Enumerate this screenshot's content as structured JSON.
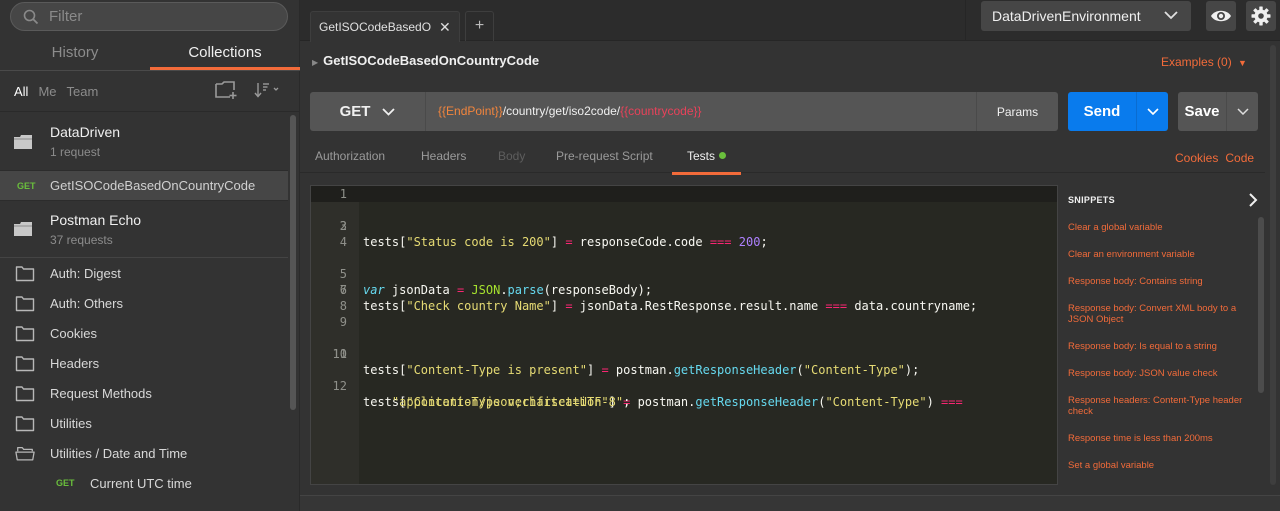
{
  "sidebar": {
    "filter_placeholder": "Filter",
    "tabs": [
      {
        "label": "History",
        "active": false
      },
      {
        "label": "Collections",
        "active": true
      }
    ],
    "owner_filters": [
      {
        "label": "All",
        "active": true
      },
      {
        "label": "Me",
        "active": false
      },
      {
        "label": "Team",
        "active": false
      }
    ],
    "collections": [
      {
        "name": "DataDriven",
        "count": "1 request"
      },
      {
        "name": "Postman Echo",
        "count": "37 requests"
      }
    ],
    "selected_request": {
      "method": "GET",
      "name": "GetISOCodeBasedOnCountryCode"
    },
    "folders": [
      {
        "name": "Auth: Digest"
      },
      {
        "name": "Auth: Others"
      },
      {
        "name": "Cookies"
      },
      {
        "name": "Headers"
      },
      {
        "name": "Request Methods"
      },
      {
        "name": "Utilities"
      },
      {
        "name": "Utilities / Date and Time"
      }
    ],
    "sub_request": {
      "method": "GET",
      "name": "Current UTC time"
    }
  },
  "tabbar": {
    "active_tab": "GetISOCodeBasedOnCountryCode",
    "close_glyph": "✕",
    "new_tab_glyph": "+"
  },
  "environment": {
    "selected": "DataDrivenEnvironment"
  },
  "request": {
    "title": "GetISOCodeBasedOnCountryCode",
    "examples_label": "Examples (0)",
    "method": "GET",
    "url": {
      "var1": "{{EndPoint}}",
      "path": "/country/get/iso2code/",
      "var2": "{{countrycode}}"
    },
    "params_label": "Params",
    "send_label": "Send",
    "save_label": "Save"
  },
  "subtabs": [
    {
      "label": "Authorization",
      "state": "normal"
    },
    {
      "label": "Headers",
      "state": "normal"
    },
    {
      "label": "Body",
      "state": "disabled"
    },
    {
      "label": "Pre-request Script",
      "state": "normal"
    },
    {
      "label": "Tests",
      "state": "active"
    }
  ],
  "right_links": [
    "Cookies",
    "Code"
  ],
  "editor": {
    "line_numbers": [
      "1",
      "2",
      "3",
      "4",
      "5",
      "6",
      "7",
      "8",
      "9",
      "10",
      "11",
      "12"
    ],
    "lines": {
      "l2": [
        "tests[",
        "\"Status code is 200\"",
        "] ",
        "=",
        " responseCode.code ",
        "===",
        " ",
        "200",
        ";"
      ],
      "l5": [
        "var",
        " jsonData ",
        "=",
        " ",
        "JSON",
        ".",
        "parse",
        "(responseBody);"
      ],
      "l6": [
        "tests[",
        "\"Check country Name\"",
        "] ",
        "=",
        " jsonData.RestResponse.result.name ",
        "===",
        " data.countryname;"
      ],
      "l10": [
        "tests[",
        "\"Content-Type is present\"",
        "] ",
        "=",
        " postman.",
        "getResponseHeader",
        "(",
        "\"Content-Type\"",
        ");"
      ],
      "l12": [
        "tests[",
        "\"Content-Type verifitcation\"",
        "] ",
        "=",
        " postman.",
        "getResponseHeader",
        "(",
        "\"Content-Type\"",
        ") ",
        "==="
      ],
      "l12b": [
        "    ",
        "\"application/json;charset=UTF-8\"",
        ";"
      ]
    }
  },
  "snippets": {
    "heading": "SNIPPETS",
    "items": [
      "Clear a global variable",
      "Clear an environment variable",
      "Response body: Contains string",
      "Response body: Convert XML body to a JSON Object",
      "Response body: Is equal to a string",
      "Response body: JSON value check",
      "Response headers: Content-Type header check",
      "Response time is less than 200ms",
      "Set a global variable"
    ]
  },
  "colors": {
    "accent": "#f26b3a",
    "send": "#097bed",
    "get_method": "#6abf3c"
  }
}
